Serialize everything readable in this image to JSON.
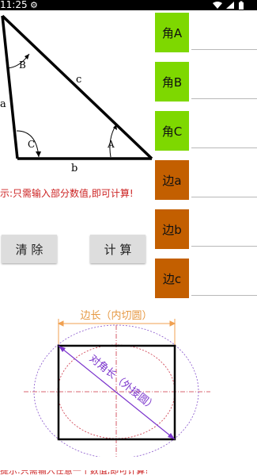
{
  "status": {
    "time": "11:25"
  },
  "triangle": {
    "label_a": "a",
    "label_b": "b",
    "label_c": "c",
    "angle_A": "A",
    "angle_B": "B",
    "angle_C": "C"
  },
  "hint": "示:只需输入部分数值,即可计算!",
  "buttons": {
    "clear": "清 除",
    "calculate": "计 算"
  },
  "fields": [
    {
      "label": "角A",
      "value": "",
      "color": "#7ed800"
    },
    {
      "label": "角B",
      "value": "",
      "color": "#7ed800"
    },
    {
      "label": "角C",
      "value": "",
      "color": "#7ed800"
    },
    {
      "label": "边a",
      "value": "",
      "color": "#c35f00"
    },
    {
      "label": "边b",
      "value": "",
      "color": "#c35f00"
    },
    {
      "label": "边c",
      "value": "",
      "color": "#c35f00"
    }
  ],
  "square": {
    "side_label": "边长（内切圆）",
    "diag_label": "对角长（外接圆）"
  },
  "bottom_hint": "提示:只需输入任意一个数值,即可计算!"
}
